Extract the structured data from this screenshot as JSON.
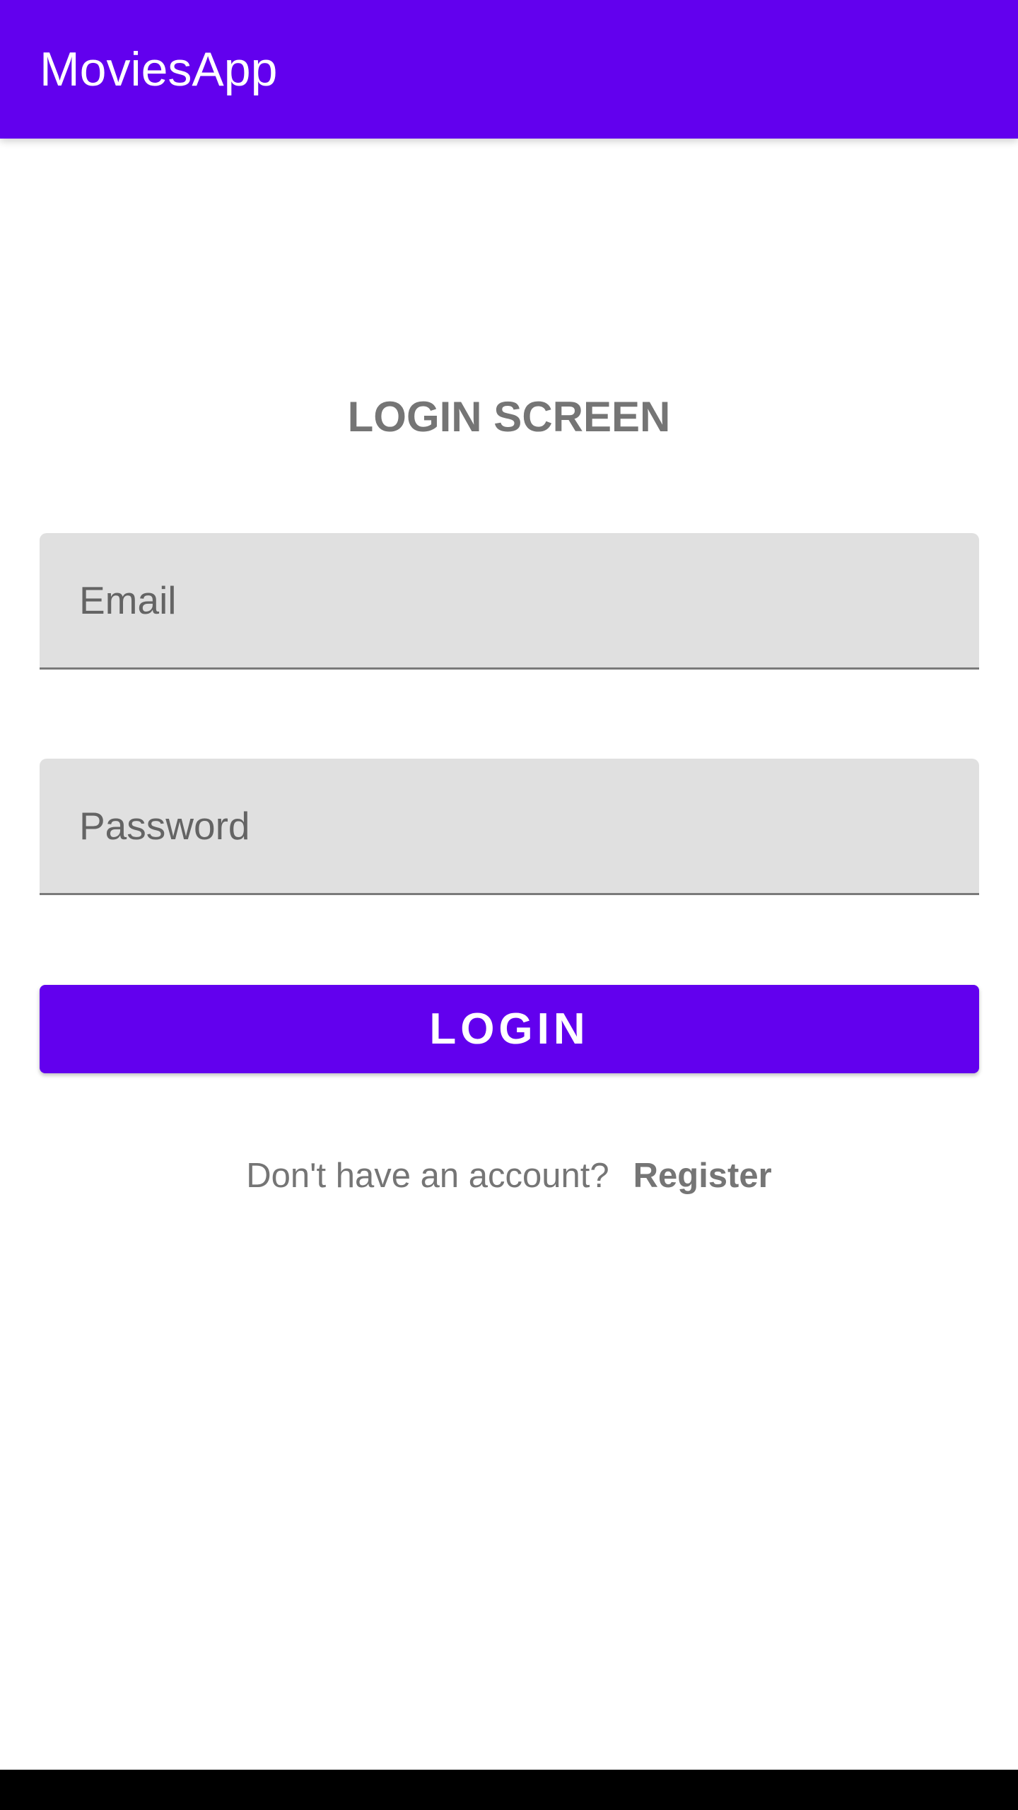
{
  "appbar": {
    "title": "MoviesApp",
    "color": "#6200EE"
  },
  "screen_title": "LOGIN SCREEN",
  "email": {
    "placeholder": "Email",
    "value": ""
  },
  "password": {
    "placeholder": "Password",
    "value": ""
  },
  "login_button": "LOGIN",
  "register": {
    "prompt": "Don't have an account?",
    "link": "Register"
  }
}
